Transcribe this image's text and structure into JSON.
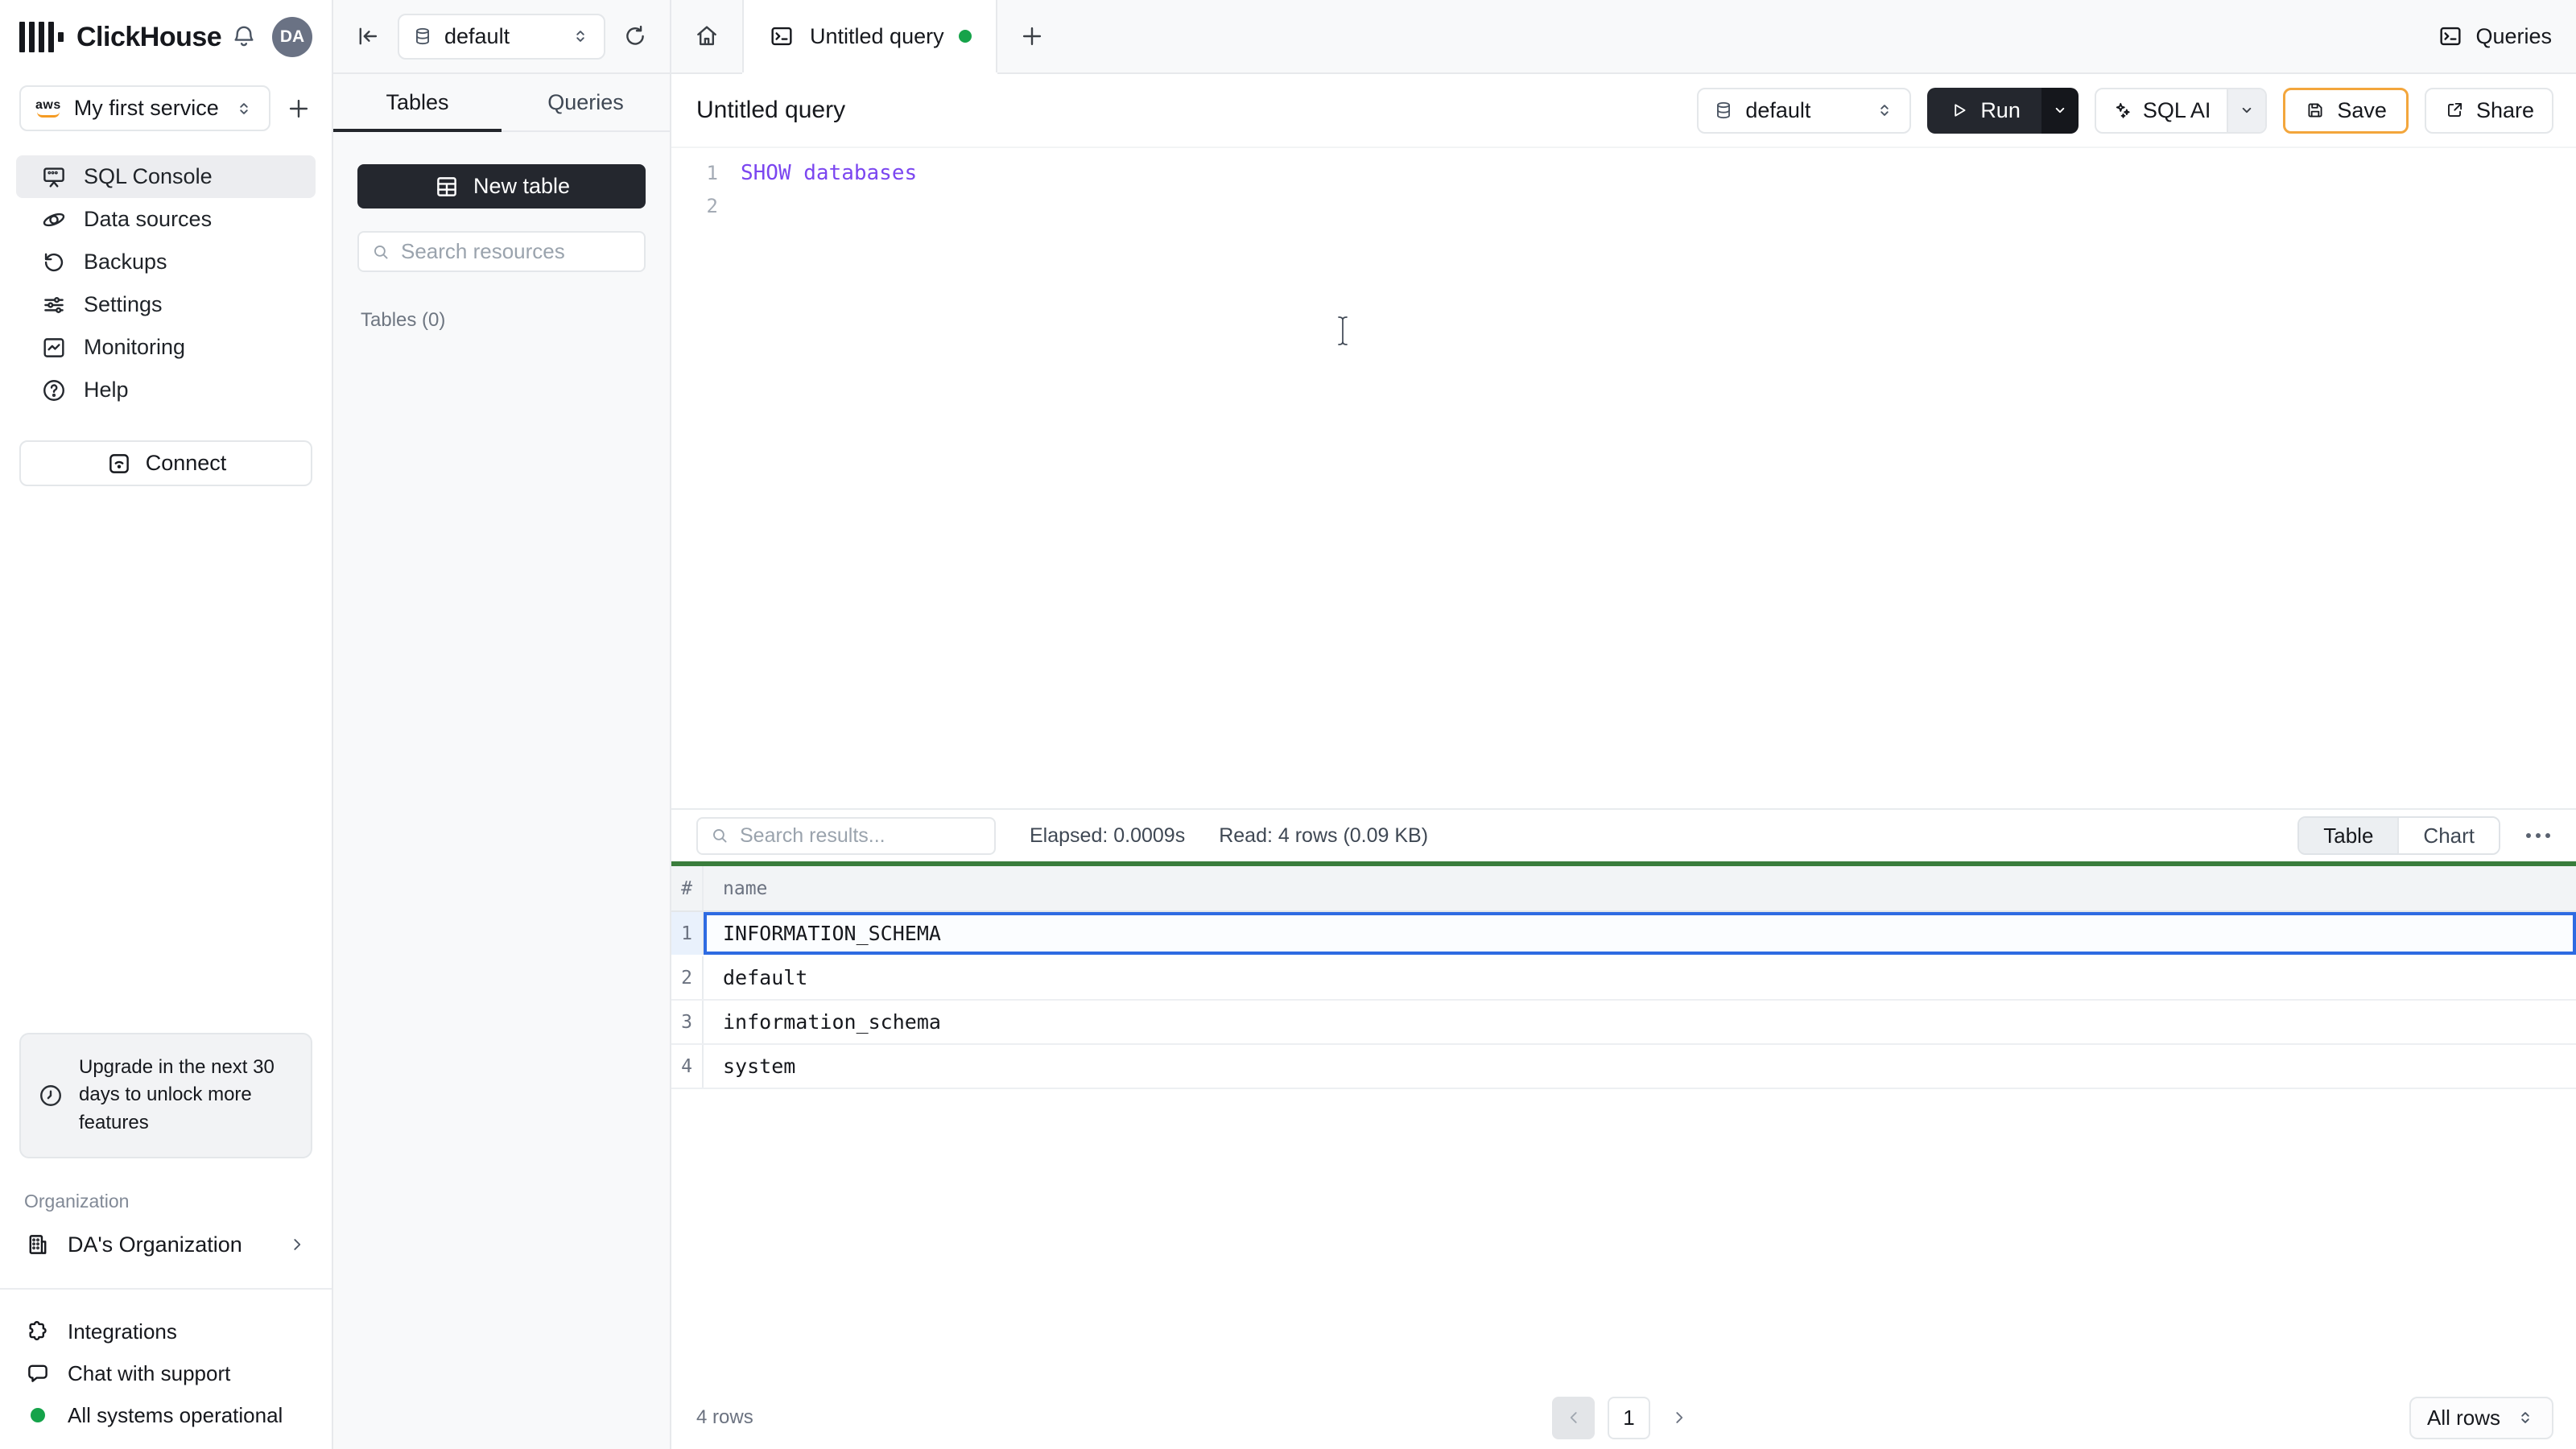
{
  "brand": {
    "name": "ClickHouse",
    "avatar": "DA"
  },
  "sidebar": {
    "service": {
      "name": "My first service",
      "provider": "aws"
    },
    "nav": [
      {
        "label": "SQL Console"
      },
      {
        "label": "Data sources"
      },
      {
        "label": "Backups"
      },
      {
        "label": "Settings"
      },
      {
        "label": "Monitoring"
      },
      {
        "label": "Help"
      }
    ],
    "connect": "Connect",
    "upgrade_notice": "Upgrade in the next 30 days to unlock more features",
    "org_section": "Organization",
    "org_name": "DA's Organization",
    "integrations": "Integrations",
    "chat": "Chat with support",
    "status": "All systems operational"
  },
  "tabbar": {
    "database": "default",
    "tab": "Untitled query",
    "queries": "Queries"
  },
  "explorer": {
    "tab_tables": "Tables",
    "tab_queries": "Queries",
    "new_table": "New table",
    "search_placeholder": "Search resources",
    "section": "Tables (0)"
  },
  "query": {
    "title": "Untitled query",
    "database": "default",
    "run": "Run",
    "sql_ai": "SQL AI",
    "save": "Save",
    "share": "Share"
  },
  "editor": {
    "lines": [
      {
        "number": "1",
        "code": "SHOW databases"
      },
      {
        "number": "2",
        "code": ""
      }
    ]
  },
  "results": {
    "search_placeholder": "Search results...",
    "elapsed": "Elapsed: 0.0009s",
    "read": "Read: 4 rows (0.09 KB)",
    "view_table": "Table",
    "view_chart": "Chart",
    "table": {
      "col_index": "#",
      "col_name": "name",
      "rows": [
        {
          "index": "1",
          "name": "INFORMATION_SCHEMA"
        },
        {
          "index": "2",
          "name": "default"
        },
        {
          "index": "3",
          "name": "information_schema"
        },
        {
          "index": "4",
          "name": "system"
        }
      ]
    },
    "footer": {
      "count": "4 rows",
      "page": "1",
      "page_size": "All rows"
    }
  },
  "colors": {
    "sql_keyword_purple": "#7b46f0",
    "success_green": "#16a34a",
    "result_bar_green": "#3a7d3c",
    "selection_blue": "#2e6be2",
    "save_border_orange": "#f3a63c",
    "dark_button": "#24272e"
  }
}
